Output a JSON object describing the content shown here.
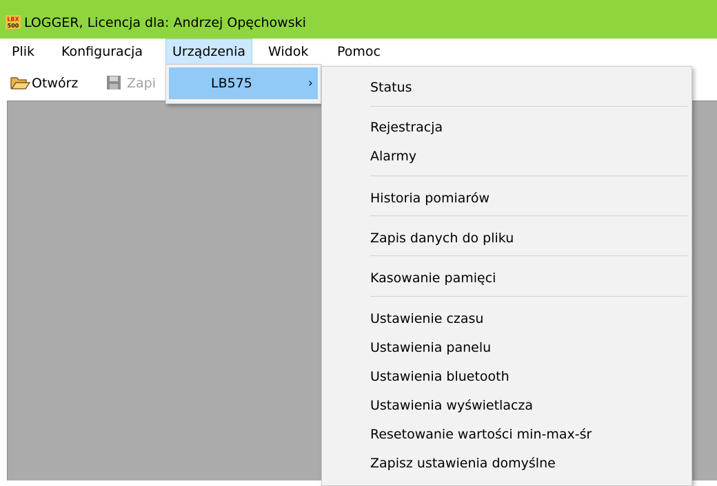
{
  "window": {
    "title": "LOGGER, Licencja dla: Andrzej Opęchowski",
    "logo_text_top": "LBX",
    "logo_text_bottom": "500",
    "logo_icon": "app-logo-icon",
    "colors": {
      "titlebar": "#8fd53e",
      "workspace": "#ababab",
      "highlight": "#91c9f7",
      "menu_active": "#cce8ff"
    }
  },
  "menubar": {
    "items": [
      {
        "label": "Plik"
      },
      {
        "label": "Konfiguracja"
      },
      {
        "label": "Urządzenia"
      },
      {
        "label": "Widok"
      },
      {
        "label": "Pomoc"
      }
    ]
  },
  "toolbar": {
    "open_label": "Otwórz",
    "open_icon": "folder-open-icon",
    "save_label": "Zapi",
    "save_icon": "floppy-disk-icon"
  },
  "submenu": {
    "device_label": "LB575",
    "chevron": "›",
    "chevron_icon": "chevron-right-icon"
  },
  "device_menu": {
    "items": [
      {
        "label": "Status"
      },
      {
        "label": "Rejestracja"
      },
      {
        "label": "Alarmy"
      },
      {
        "label": "Historia pomiarów"
      },
      {
        "label": "Zapis danych do pliku"
      },
      {
        "label": "Kasowanie pamięci"
      },
      {
        "label": "Ustawienie czasu"
      },
      {
        "label": "Ustawienia panelu"
      },
      {
        "label": "Ustawienia bluetooth"
      },
      {
        "label": "Ustawienia wyświetlacza"
      },
      {
        "label": "Resetowanie wartości min-max-śr"
      },
      {
        "label": "Zapisz ustawienia domyślne"
      }
    ]
  }
}
